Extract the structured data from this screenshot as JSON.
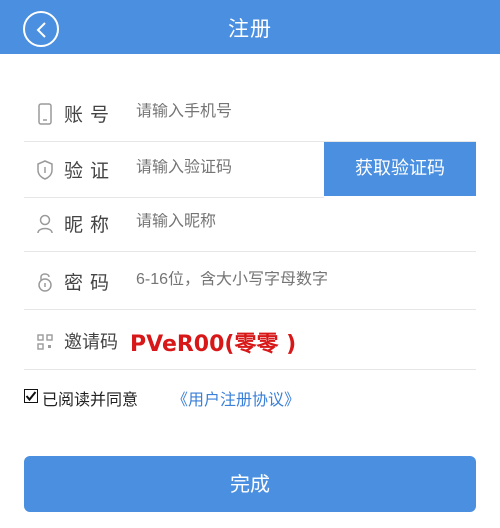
{
  "header": {
    "title": "注册",
    "back_icon": "chevron-left-icon"
  },
  "form": {
    "account": {
      "label": "账号",
      "placeholder": "请输入手机号",
      "icon": "phone-icon"
    },
    "verify": {
      "label": "验证",
      "placeholder": "请输入验证码",
      "icon": "shield-icon",
      "button": "获取验证码"
    },
    "nickname": {
      "label": "昵称",
      "placeholder": "请输入昵称",
      "icon": "user-icon"
    },
    "password": {
      "label": "密码",
      "placeholder": "6-16位，含大小写字母数字",
      "icon": "lock-icon"
    },
    "invite": {
      "label": "邀请码",
      "value": "PVeR00(零零 )",
      "icon": "qr-icon"
    }
  },
  "agreement": {
    "checked": true,
    "text": "已阅读并同意",
    "link": "《用户注册协议》"
  },
  "submit": {
    "label": "完成"
  },
  "colors": {
    "primary": "#4a8fe0",
    "invite_red": "#d81818",
    "link": "#3a7fd8"
  }
}
